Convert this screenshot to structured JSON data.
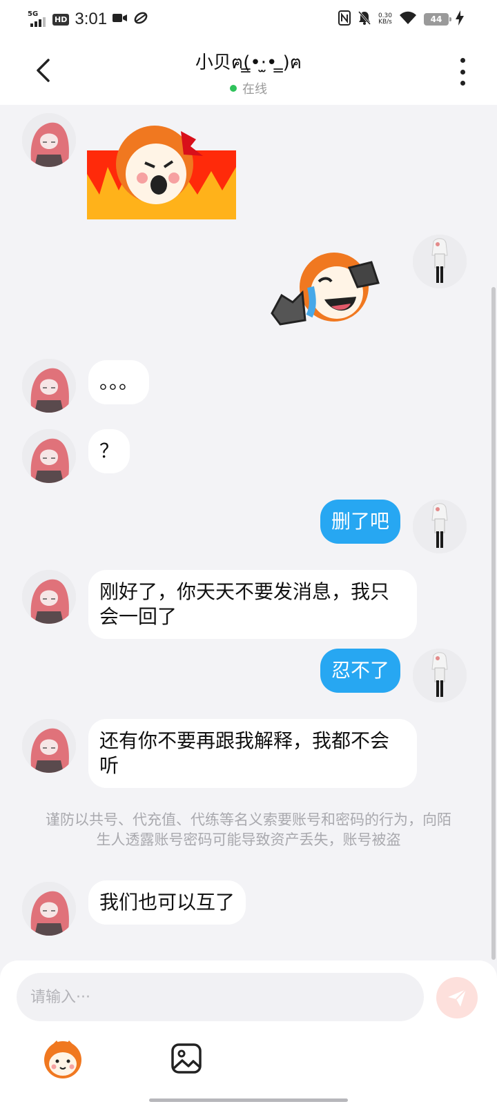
{
  "status_bar": {
    "network": "5G",
    "hd": "HD",
    "time": "3:01",
    "speed_value": "0.30",
    "speed_unit": "KB/s",
    "battery": "44"
  },
  "header": {
    "contact_name": "小贝ฅ(̳•·̫• ̳)ฅ",
    "status": "在线"
  },
  "messages": [
    {
      "from": "contact",
      "type": "sticker",
      "sticker": "angry-fire-sticker"
    },
    {
      "from": "me",
      "type": "sticker",
      "sticker": "crying-laugh-sticker"
    },
    {
      "from": "contact",
      "type": "text",
      "text": "。。。"
    },
    {
      "from": "contact",
      "type": "text",
      "text": "？"
    },
    {
      "from": "me",
      "type": "text",
      "text": "删了吧"
    },
    {
      "from": "contact",
      "type": "text",
      "text": "刚好了，你天天不要发消息，我只会一回了"
    },
    {
      "from": "me",
      "type": "text",
      "text": "忍不了"
    },
    {
      "from": "contact",
      "type": "text",
      "text": "还有你不要再跟我解释，我都不会听"
    },
    {
      "from": "contact",
      "type": "text",
      "text": "我们也可以互了"
    }
  ],
  "notice": "谨防以共号、代充值、代练等名义索要账号和密码的行为，向陌生人透露账号密码可能导致资产丢失，账号被盗",
  "input": {
    "placeholder": "请输入···"
  },
  "colors": {
    "outgoing_bubble": "#27a7f2",
    "incoming_bubble": "#ffffff",
    "online_dot": "#2fc25b",
    "send_button": "#fde0dc"
  }
}
